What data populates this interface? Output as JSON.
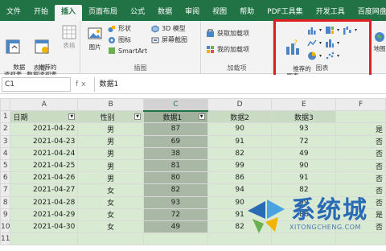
{
  "ribbon": {
    "tabs": [
      "文件",
      "开始",
      "插入",
      "页面布局",
      "公式",
      "数据",
      "审阅",
      "视图",
      "帮助",
      "PDF工具集",
      "开发工具",
      "百度网盘"
    ],
    "active_tab": "插入",
    "groups": {
      "tables": {
        "label": "表格",
        "pivot": "数据\n透视表",
        "recommended_pivot": "推荐的\n数据透视表",
        "table": "表格"
      },
      "illustrations": {
        "label": "插图",
        "pictures": "图片",
        "shapes": "形状",
        "icons": "图标",
        "smartart": "SmartArt",
        "model3d": "3D 模型",
        "screenshot": "屏幕截图"
      },
      "addins": {
        "label": "加载项",
        "get": "获取加载项",
        "mine": "我的加载项"
      },
      "charts": {
        "label": "图表",
        "recommended": "推荐的\n图表",
        "maps": "地图"
      }
    }
  },
  "formula_bar": {
    "name_box": "C1",
    "fx": "fx",
    "value": "数据1"
  },
  "sheet": {
    "columns": [
      "A",
      "B",
      "C",
      "D",
      "E",
      "F"
    ],
    "row_numbers": [
      "1",
      "2",
      "3",
      "4",
      "5",
      "6",
      "7",
      "8",
      "9",
      "10",
      "11"
    ],
    "headers": [
      "日期",
      "性别",
      "数据1",
      "数据2",
      "数据3"
    ],
    "rows": [
      [
        "2021-04-22",
        "男",
        "87",
        "90",
        "93",
        "是"
      ],
      [
        "2021-04-23",
        "男",
        "69",
        "91",
        "72",
        "否"
      ],
      [
        "2021-04-24",
        "男",
        "38",
        "82",
        "49",
        "否"
      ],
      [
        "2021-04-25",
        "男",
        "81",
        "99",
        "90",
        "否"
      ],
      [
        "2021-04-26",
        "男",
        "80",
        "86",
        "91",
        "否"
      ],
      [
        "2021-04-27",
        "女",
        "82",
        "94",
        "82",
        "否"
      ],
      [
        "2021-04-28",
        "女",
        "93",
        "90",
        "99",
        "否"
      ],
      [
        "2021-04-29",
        "女",
        "72",
        "91",
        "86",
        "是"
      ],
      [
        "2021-04-30",
        "女",
        "49",
        "82",
        "",
        "否"
      ]
    ]
  },
  "watermark": {
    "title": "系统城",
    "sub": "XITONGCHENG.COM"
  },
  "colors": {
    "excel_green": "#217346",
    "highlight_red": "#e02020",
    "cell_fill": "#d9ead3"
  }
}
